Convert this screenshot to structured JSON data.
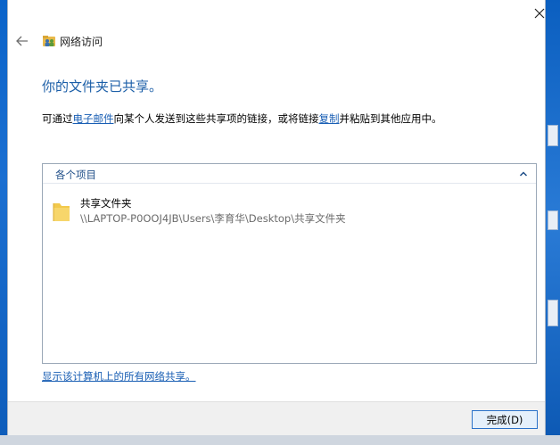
{
  "window": {
    "title": "网络访问",
    "close_symbol": "✕"
  },
  "main": {
    "heading": "你的文件夹已共享。",
    "desc_prefix": "可通过",
    "email_link": "电子邮件",
    "desc_middle": "向某个人发送到这些共享项的链接，或将链接",
    "copy_link": "复制",
    "desc_suffix": "并粘贴到其他应用中。"
  },
  "items_group": {
    "title": "各个项目",
    "items": [
      {
        "name": "共享文件夹",
        "path": "\\\\LAPTOP-P0OOJ4JB\\Users\\李育华\\Desktop\\共享文件夹"
      }
    ]
  },
  "show_all_link": "显示该计算机上的所有网络共享。",
  "footer": {
    "done_label": "完成(D)"
  },
  "colors": {
    "accent": "#1c5fa8",
    "link": "#1a5fb4",
    "button_border": "#2a71c9"
  }
}
